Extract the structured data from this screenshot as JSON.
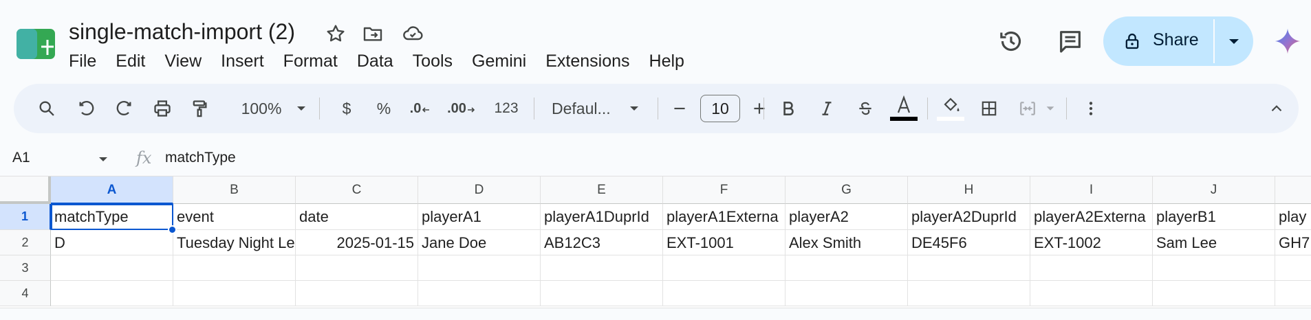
{
  "document": {
    "title": "single-match-import (2)"
  },
  "menu": [
    "File",
    "Edit",
    "View",
    "Insert",
    "Format",
    "Data",
    "Tools",
    "Gemini",
    "Extensions",
    "Help"
  ],
  "header": {
    "share_label": "Share"
  },
  "toolbar": {
    "zoom": "100%",
    "currency": "$",
    "percent": "%",
    "decrease_decimals": ".0",
    "increase_decimals": ".00",
    "number_format": "123",
    "font": "Defaul...",
    "font_size": "10"
  },
  "formula_bar": {
    "cell_ref": "A1",
    "fx": "fx",
    "value": "matchType"
  },
  "sheet": {
    "columns": [
      "A",
      "B",
      "C",
      "D",
      "E",
      "F",
      "G",
      "H",
      "I",
      "J"
    ],
    "rows": [
      "1",
      "2",
      "3",
      "4"
    ],
    "cells": [
      [
        "matchType",
        "event",
        "date",
        "playerA1",
        "playerA1DuprId",
        "playerA1Externa",
        "playerA2",
        "playerA2DuprId",
        "playerA2Externa",
        "playerB1",
        "play"
      ],
      [
        "D",
        "Tuesday Night Le",
        "2025-01-15",
        "Jane Doe",
        "AB12C3",
        "EXT-1001",
        "Alex Smith",
        "DE45F6",
        "EXT-1002",
        "Sam Lee",
        "GH7"
      ]
    ],
    "active_cell": "A1"
  },
  "colors": {
    "accent": "#0b57d0",
    "share_bg": "#c2e7ff",
    "header_active_bg": "#d3e3fd",
    "logo_green": "#34a853"
  }
}
